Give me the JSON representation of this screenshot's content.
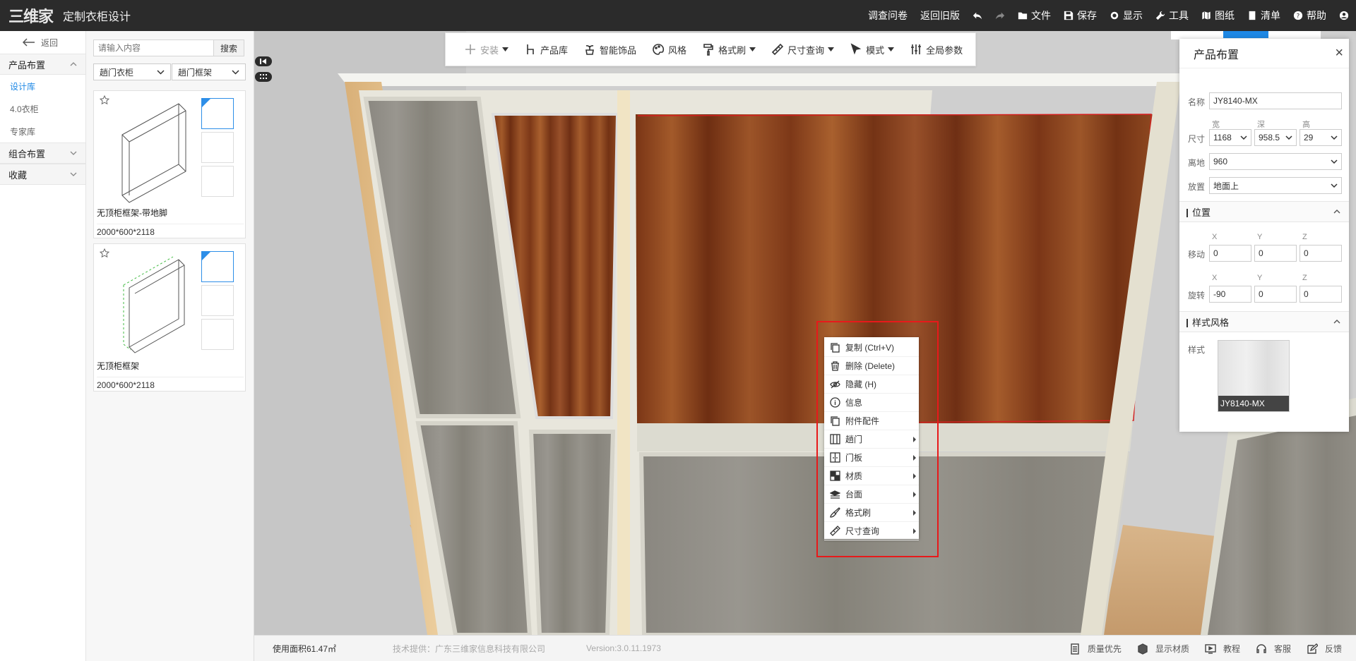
{
  "app": {
    "logo_text": "三维家",
    "title": "定制衣柜设计"
  },
  "topmenu": {
    "survey": "调查问卷",
    "old_version": "返回旧版",
    "file": "文件",
    "save": "保存",
    "display": "显示",
    "tools": "工具",
    "drawings": "图纸",
    "list": "清单",
    "help": "帮助"
  },
  "leftnav": {
    "back": "返回",
    "sections": [
      {
        "label": "产品布置"
      },
      {
        "label": "组合布置"
      },
      {
        "label": "收藏"
      }
    ],
    "items": [
      {
        "label": "设计库"
      },
      {
        "label": "4.0衣柜"
      },
      {
        "label": "专家库"
      }
    ]
  },
  "library": {
    "search_placeholder": "请输入内容",
    "search_button": "搜索",
    "filter_category": "趟门衣柜",
    "filter_type": "趟门框架",
    "products": [
      {
        "name": "无顶柜框架-带地脚",
        "dims": "2000*600*2118"
      },
      {
        "name": "无顶柜框架",
        "dims": "2000*600*2118"
      }
    ]
  },
  "toolbar": {
    "install": "安装",
    "product_library": "产品库",
    "smart_decor": "智能饰品",
    "style": "风格",
    "format_brush": "格式刷",
    "dimension_query": "尺寸查询",
    "mode": "模式",
    "global_params": "全局参数"
  },
  "context_menu": [
    {
      "label": "复制 (Ctrl+V)",
      "icon": "copy-icon",
      "submenu": false
    },
    {
      "label": "删除 (Delete)",
      "icon": "trash-icon",
      "submenu": false
    },
    {
      "label": "隐藏 (H)",
      "icon": "eye-hide-icon",
      "submenu": false
    },
    {
      "label": "信息",
      "icon": "info-icon",
      "submenu": false
    },
    {
      "label": "附件配件",
      "icon": "accessory-icon",
      "submenu": false
    },
    {
      "label": "趟门",
      "icon": "sliding-door-icon",
      "submenu": true
    },
    {
      "label": "门板",
      "icon": "door-panel-icon",
      "submenu": true
    },
    {
      "label": "材质",
      "icon": "material-icon",
      "submenu": true
    },
    {
      "label": "台面",
      "icon": "countertop-icon",
      "submenu": true
    },
    {
      "label": "格式刷",
      "icon": "brush-icon",
      "submenu": true
    },
    {
      "label": "尺寸查询",
      "icon": "ruler-icon",
      "submenu": true
    }
  ],
  "properties": {
    "title": "产品布置",
    "close": "×",
    "name_label": "名称",
    "name_value": "JY8140-MX",
    "size_label": "尺寸",
    "width_label": "宽",
    "depth_label": "深",
    "height_label": "高",
    "width": "1168",
    "depth": "958.5",
    "height": "29",
    "elevation_label": "离地",
    "elevation": "960",
    "placement_label": "放置",
    "placement": "地面上",
    "position_section": "位置",
    "x": "X",
    "y": "Y",
    "z": "Z",
    "move_label": "移动",
    "move": [
      "0",
      "0",
      "0"
    ],
    "rotate_label": "旋转",
    "rotate": [
      "-90",
      "0",
      "0"
    ],
    "style_section": "样式风格",
    "style_label": "样式",
    "swatch_name": "JY8140-MX"
  },
  "statusbar": {
    "area": "使用面积61.47㎡",
    "provider": "技术提供：广东三维家信息科技有限公司",
    "version": "Version:3.0.11.1973",
    "quality": "质量优先",
    "show_material": "显示材质",
    "tutorial": "教程",
    "service": "客服",
    "feedback": "反馈"
  },
  "colors": {
    "topbar": "#2b2b2b",
    "accent": "#1e88e5",
    "highlight": "#e8191a",
    "wood": "#8a3f1c",
    "panel_gray": "#8c8a84"
  }
}
